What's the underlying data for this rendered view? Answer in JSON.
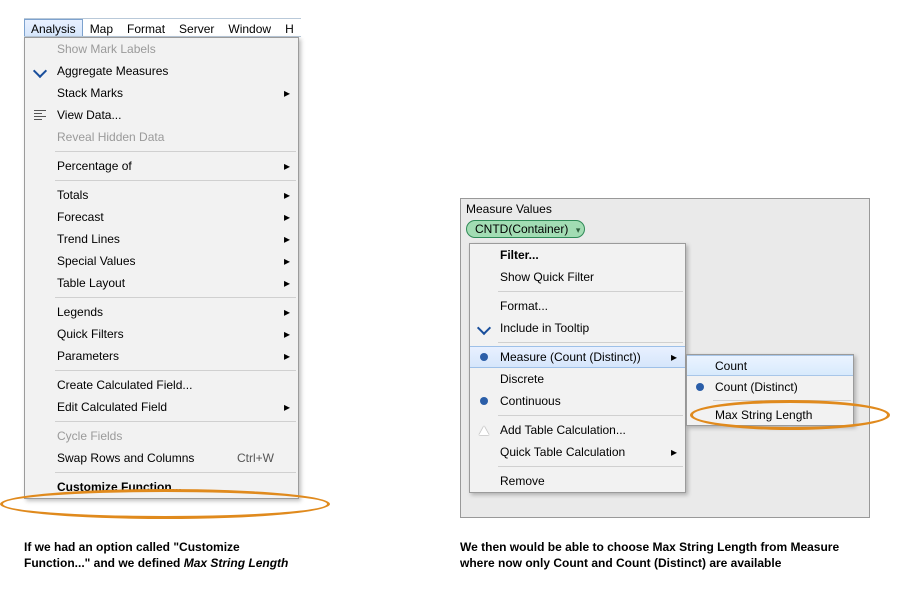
{
  "menubar": [
    "Analysis",
    "Map",
    "Format",
    "Server",
    "Window",
    "H"
  ],
  "dropdown": [
    {
      "label": "Show Mark Labels",
      "disabled": true
    },
    {
      "label": "Aggregate Measures",
      "icon": "check"
    },
    {
      "label": "Stack Marks",
      "submenu": true
    },
    {
      "label": "View Data...",
      "icon": "bars"
    },
    {
      "label": "Reveal Hidden Data",
      "disabled": true
    },
    {
      "sep": true
    },
    {
      "label": "Percentage of",
      "submenu": true
    },
    {
      "sep": true
    },
    {
      "label": "Totals",
      "submenu": true
    },
    {
      "label": "Forecast",
      "submenu": true
    },
    {
      "label": "Trend Lines",
      "submenu": true
    },
    {
      "label": "Special Values",
      "submenu": true
    },
    {
      "label": "Table Layout",
      "submenu": true
    },
    {
      "sep": true
    },
    {
      "label": "Legends",
      "submenu": true
    },
    {
      "label": "Quick Filters",
      "submenu": true
    },
    {
      "label": "Parameters",
      "submenu": true
    },
    {
      "sep": true
    },
    {
      "label": "Create Calculated Field..."
    },
    {
      "label": "Edit Calculated Field",
      "submenu": true
    },
    {
      "sep": true
    },
    {
      "label": "Cycle Fields",
      "disabled": true
    },
    {
      "label": "Swap Rows and Columns",
      "accel": "Ctrl+W"
    },
    {
      "sep": true
    },
    {
      "label": "Customize Function...",
      "strong": true
    }
  ],
  "caption_left": {
    "t1": "If we had an option called \"Customize Function...\" and we defined ",
    "em": "Max String Length"
  },
  "right": {
    "measure_values": "Measure Values",
    "pill": "CNTD(Container)",
    "ctx": [
      {
        "label": "Filter...",
        "strong": true
      },
      {
        "label": "Show Quick Filter"
      },
      {
        "sep": true
      },
      {
        "label": "Format..."
      },
      {
        "label": "Include in Tooltip",
        "icon": "check"
      },
      {
        "sep": true
      },
      {
        "label": "Measure (Count (Distinct))",
        "icon": "dot-solid",
        "submenu": true,
        "hl": true
      },
      {
        "label": "Discrete"
      },
      {
        "label": "Continuous",
        "icon": "dot-solid"
      },
      {
        "sep": true
      },
      {
        "label": "Add Table Calculation...",
        "icon": "tri"
      },
      {
        "label": "Quick Table Calculation",
        "submenu": true
      },
      {
        "sep": true
      },
      {
        "label": "Remove"
      }
    ],
    "subsub": [
      {
        "label": "Count",
        "hl": true
      },
      {
        "label": "Count (Distinct)",
        "icon": "dot-solid"
      },
      {
        "sep": true
      },
      {
        "label": "Max String Length"
      }
    ]
  },
  "caption_right": "We then would be able to choose Max String Length from Measure where now only Count and Count (Distinct) are available"
}
